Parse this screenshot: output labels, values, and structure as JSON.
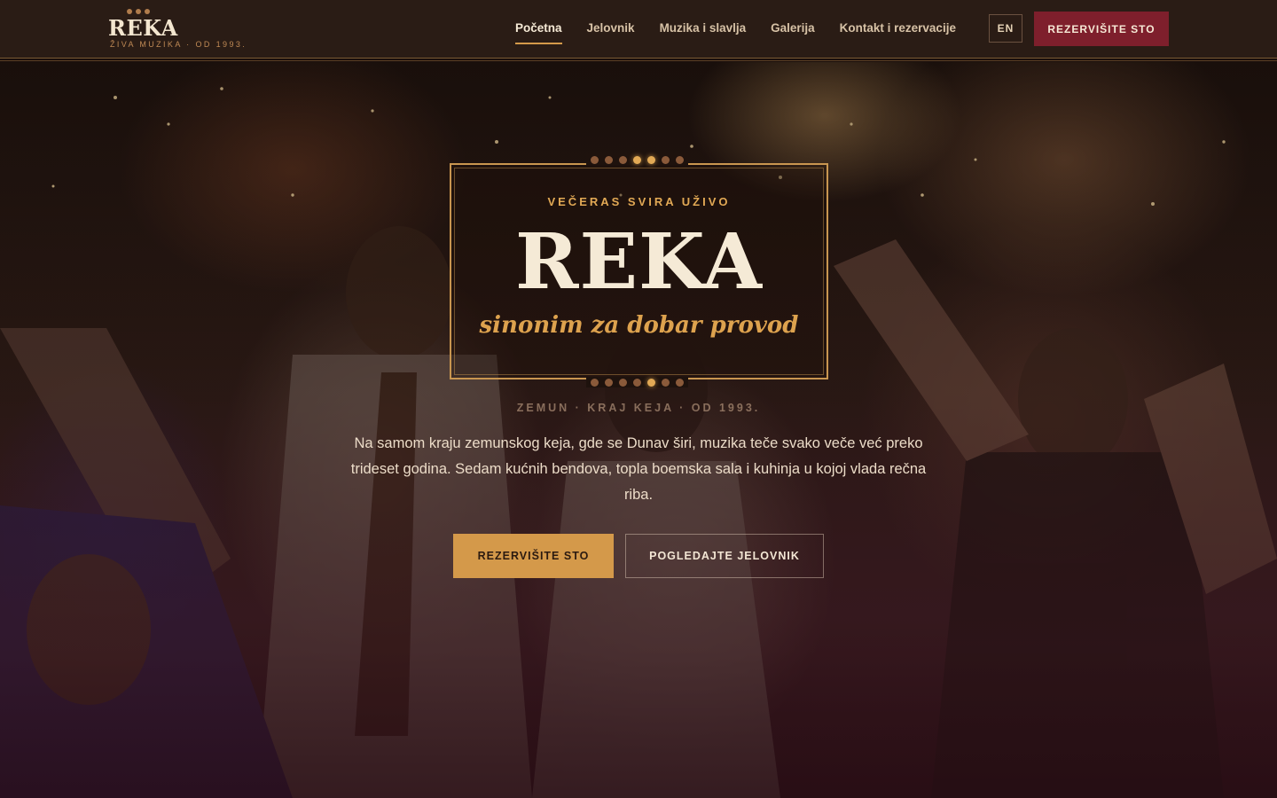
{
  "header": {
    "logo": {
      "wordmark": "REKA",
      "tagline": "ŽIVA MUZIKA · OD 1993."
    },
    "nav": [
      {
        "label": "Početna",
        "active": true
      },
      {
        "label": "Jelovnik",
        "active": false
      },
      {
        "label": "Muzika i slavlja",
        "active": false
      },
      {
        "label": "Galerija",
        "active": false
      },
      {
        "label": "Kontakt i rezervacije",
        "active": false
      }
    ],
    "language_label": "EN",
    "cta_label": "REZERVIŠITE STO"
  },
  "hero": {
    "eyebrow": "VEČERAS SVIRA UŽIVO",
    "title": "REKA",
    "tagline": "sinonim za dobar provod",
    "meta": "ZEMUN · KRAJ KEJA · OD 1993.",
    "description": "Na samom kraju zemunskog keja, gde se Dunav širi, muzika teče svako veče već preko trideset godina. Sedam kućnih bendova, topla boemska sala i kuhinja u kojoj vlada rečna riba.",
    "primary_button": "REZERVIŠITE STO",
    "secondary_button": "POGLEDAJTE JELOVNIK",
    "background_image": "photo of guests dancing"
  },
  "colors": {
    "header_bg": "#2a1c15",
    "accent_gold": "#d4994a",
    "cta_burgundy": "#7e1f2c",
    "title_cream": "#f5ead6"
  }
}
